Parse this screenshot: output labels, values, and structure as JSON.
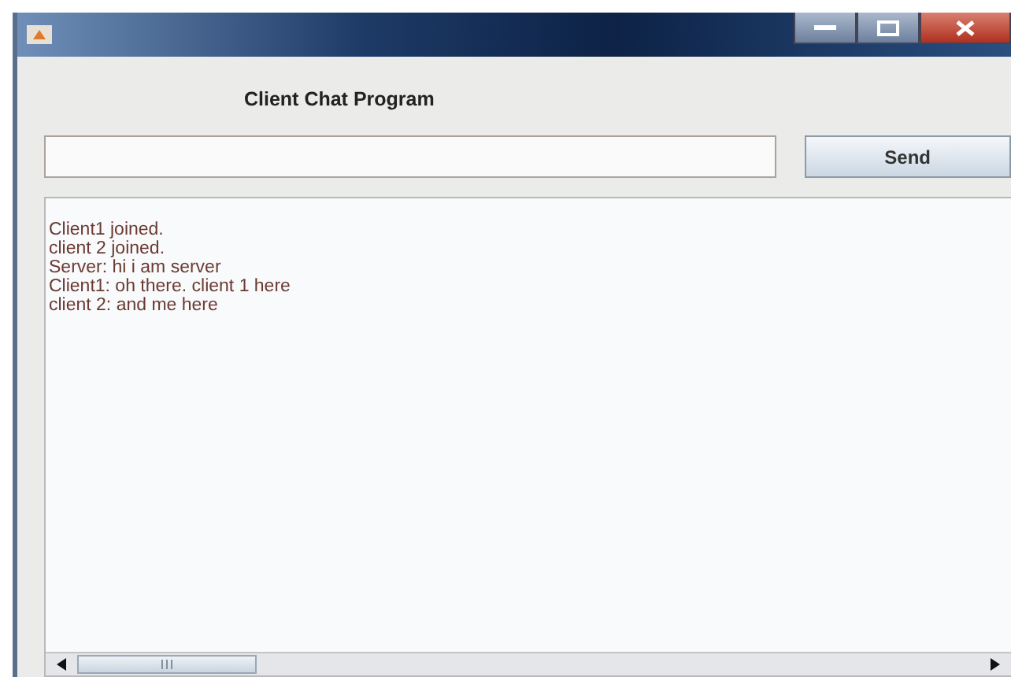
{
  "heading": "Client Chat Program",
  "send_button": "Send",
  "messages": [
    "Client1 joined.",
    "client 2 joined.",
    "Server: hi i am server",
    "Client1: oh there. client 1 here",
    "client 2: and me here"
  ]
}
